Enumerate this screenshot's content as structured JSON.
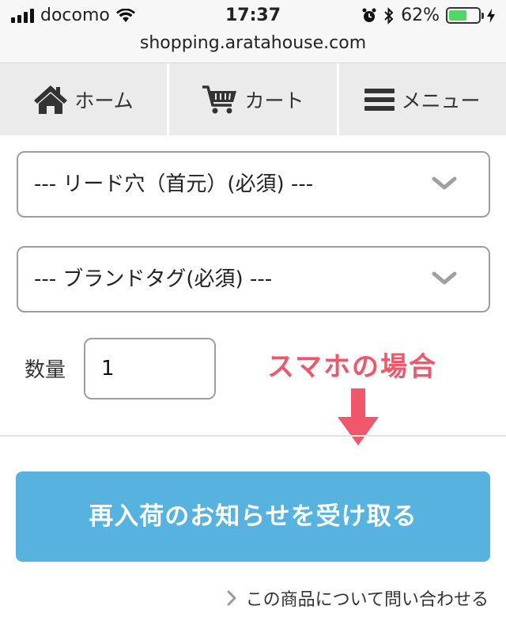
{
  "status_bar": {
    "carrier": "docomo",
    "time": "17:37",
    "battery_percent": "62%",
    "battery_level": 0.62
  },
  "url_bar": {
    "url": "shopping.aratahouse.com"
  },
  "nav": {
    "home_label": "ホーム",
    "cart_label": "カート",
    "menu_label": "メニュー"
  },
  "form": {
    "select_lead_hole": "--- リード穴（首元）(必須) ---",
    "select_brand_tag": "--- ブランドタグ(必須) ---",
    "quantity_label": "数量",
    "quantity_value": "1"
  },
  "annotation": {
    "note": "スマホの場合"
  },
  "actions": {
    "notify_button": "再入荷のお知らせを受け取る",
    "inquiry_link": "この商品について問い合わせる"
  },
  "colors": {
    "button": "#56b3e0",
    "note": "#f0576a",
    "battery": "#4cd964"
  }
}
